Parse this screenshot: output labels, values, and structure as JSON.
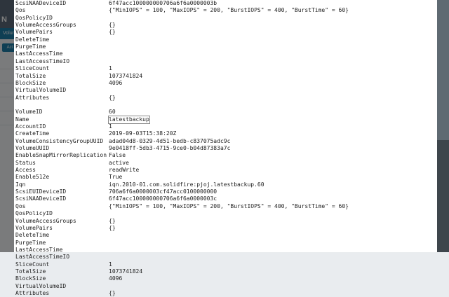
{
  "background_ui": {
    "logo": "N",
    "tab": "Volume",
    "button": "Act"
  },
  "terminal": {
    "rows": [
      {
        "key": "ScsiNAADeviceID",
        "value": "6f47acc100000000706a6f6a0000003b"
      },
      {
        "key": "Qos",
        "value": "{\"MinIOPS\" = 100, \"MaxIOPS\" = 200, \"BurstIOPS\" = 400, \"BurstTime\" = 60}"
      },
      {
        "key": "QosPolicyID",
        "value": ""
      },
      {
        "key": "VolumeAccessGroups",
        "value": "{}"
      },
      {
        "key": "VolumePairs",
        "value": "{}"
      },
      {
        "key": "DeleteTime",
        "value": ""
      },
      {
        "key": "PurgeTime",
        "value": ""
      },
      {
        "key": "LastAccessTime",
        "value": ""
      },
      {
        "key": "LastAccessTimeIO",
        "value": ""
      },
      {
        "key": "SliceCount",
        "value": "1"
      },
      {
        "key": "TotalSize",
        "value": "1073741824"
      },
      {
        "key": "BlockSize",
        "value": "4096"
      },
      {
        "key": "VirtualVolumeID",
        "value": ""
      },
      {
        "key": "Attributes",
        "value": "{}"
      },
      {
        "key": "",
        "value": ""
      },
      {
        "key": "VolumeID",
        "value": "60"
      },
      {
        "key": "Name",
        "value": "latestbackup"
      },
      {
        "key": "AccountID",
        "value": "1"
      },
      {
        "key": "CreateTime",
        "value": "2019-09-03T15:38:20Z"
      },
      {
        "key": "VolumeConsistencyGroupUUID",
        "value": "adad04d8-0329-4d51-bedb-c837075adc9c"
      },
      {
        "key": "VolumeUUID",
        "value": "9e0418ff-5db3-4715-9ce0-b04d87383a7c"
      },
      {
        "key": "EnableSnapMirrorReplication",
        "value": "False"
      },
      {
        "key": "Status",
        "value": "active"
      },
      {
        "key": "Access",
        "value": "readWrite"
      },
      {
        "key": "Enable512e",
        "value": "True"
      },
      {
        "key": "Iqn",
        "value": "iqn.2010-01.com.solidfire:pjoj.latestbackup.60"
      },
      {
        "key": "ScsiEUIDeviceID",
        "value": "706a6f6a0000003cf47acc0100000000"
      },
      {
        "key": "ScsiNAADeviceID",
        "value": "6f47acc100000000706a6f6a0000003c"
      },
      {
        "key": "Qos",
        "value": "{\"MinIOPS\" = 100, \"MaxIOPS\" = 200, \"BurstIOPS\" = 400, \"BurstTime\" = 60}"
      },
      {
        "key": "QosPolicyID",
        "value": ""
      },
      {
        "key": "VolumeAccessGroups",
        "value": "{}"
      },
      {
        "key": "VolumePairs",
        "value": "{}"
      },
      {
        "key": "DeleteTime",
        "value": ""
      },
      {
        "key": "PurgeTime",
        "value": ""
      },
      {
        "key": "LastAccessTime",
        "value": ""
      },
      {
        "key": "LastAccessTimeIO",
        "value": ""
      },
      {
        "key": "SliceCount",
        "value": "1"
      },
      {
        "key": "TotalSize",
        "value": "1073741824"
      },
      {
        "key": "BlockSize",
        "value": "4096"
      },
      {
        "key": "VirtualVolumeID",
        "value": ""
      },
      {
        "key": "Attributes",
        "value": "{}"
      }
    ]
  }
}
